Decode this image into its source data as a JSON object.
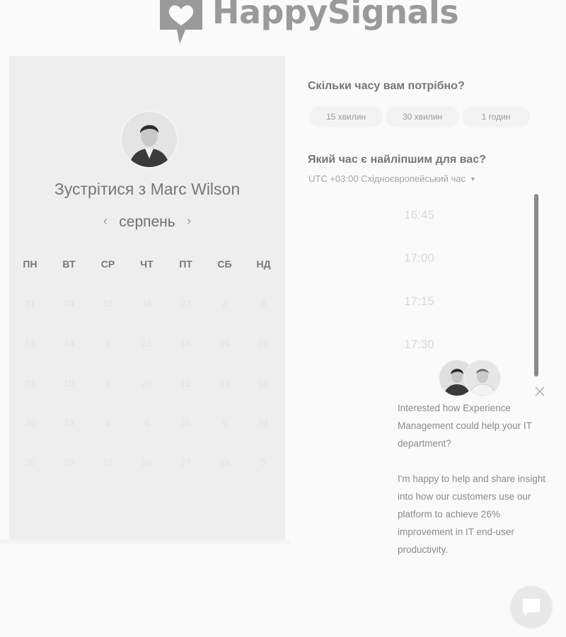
{
  "brand": {
    "name": "HappySignals",
    "logo_color": "#9a9a9a"
  },
  "calendar": {
    "meet_title": "Зустрітися з Marc Wilson",
    "month": "серпень",
    "prev_icon": "chevron-left-icon",
    "next_icon": "chevron-right-icon",
    "weekdays": [
      "ПН",
      "ВТ",
      "СР",
      "ЧТ",
      "ПТ",
      "СБ",
      "НД"
    ],
    "weeks": [
      [
        "31",
        "24",
        "15",
        "16",
        "23",
        "2",
        "6"
      ],
      [
        "13",
        "14",
        "1",
        "21",
        "18",
        "16",
        "10"
      ],
      [
        "23",
        "10",
        "3",
        "29",
        "12",
        "13",
        "10"
      ],
      [
        "30",
        "23",
        "4",
        "6",
        "26",
        "5",
        "31"
      ],
      [
        "20",
        "20",
        "16",
        "26",
        "27",
        "18",
        "5"
      ]
    ]
  },
  "duration": {
    "question": "Скільки часу вам потрібно?",
    "options": [
      "15 хвилин",
      "30 хвилин",
      "1 годин"
    ]
  },
  "time": {
    "question": "Який час є найліпшим для вас?",
    "timezone": "UTC +03:00 Східноєвропейський час",
    "slots": [
      "16:45",
      "17:00",
      "17:15",
      "17:30"
    ]
  },
  "chat": {
    "message_1": "Interested how Experience Management could help your IT department?",
    "message_2": "I'm happy to help and share insight into how our customers use our platform to achieve 26% improvement in IT end-user productivity.",
    "close_icon": "close-icon",
    "launcher_icon": "chat-bubble-icon"
  }
}
